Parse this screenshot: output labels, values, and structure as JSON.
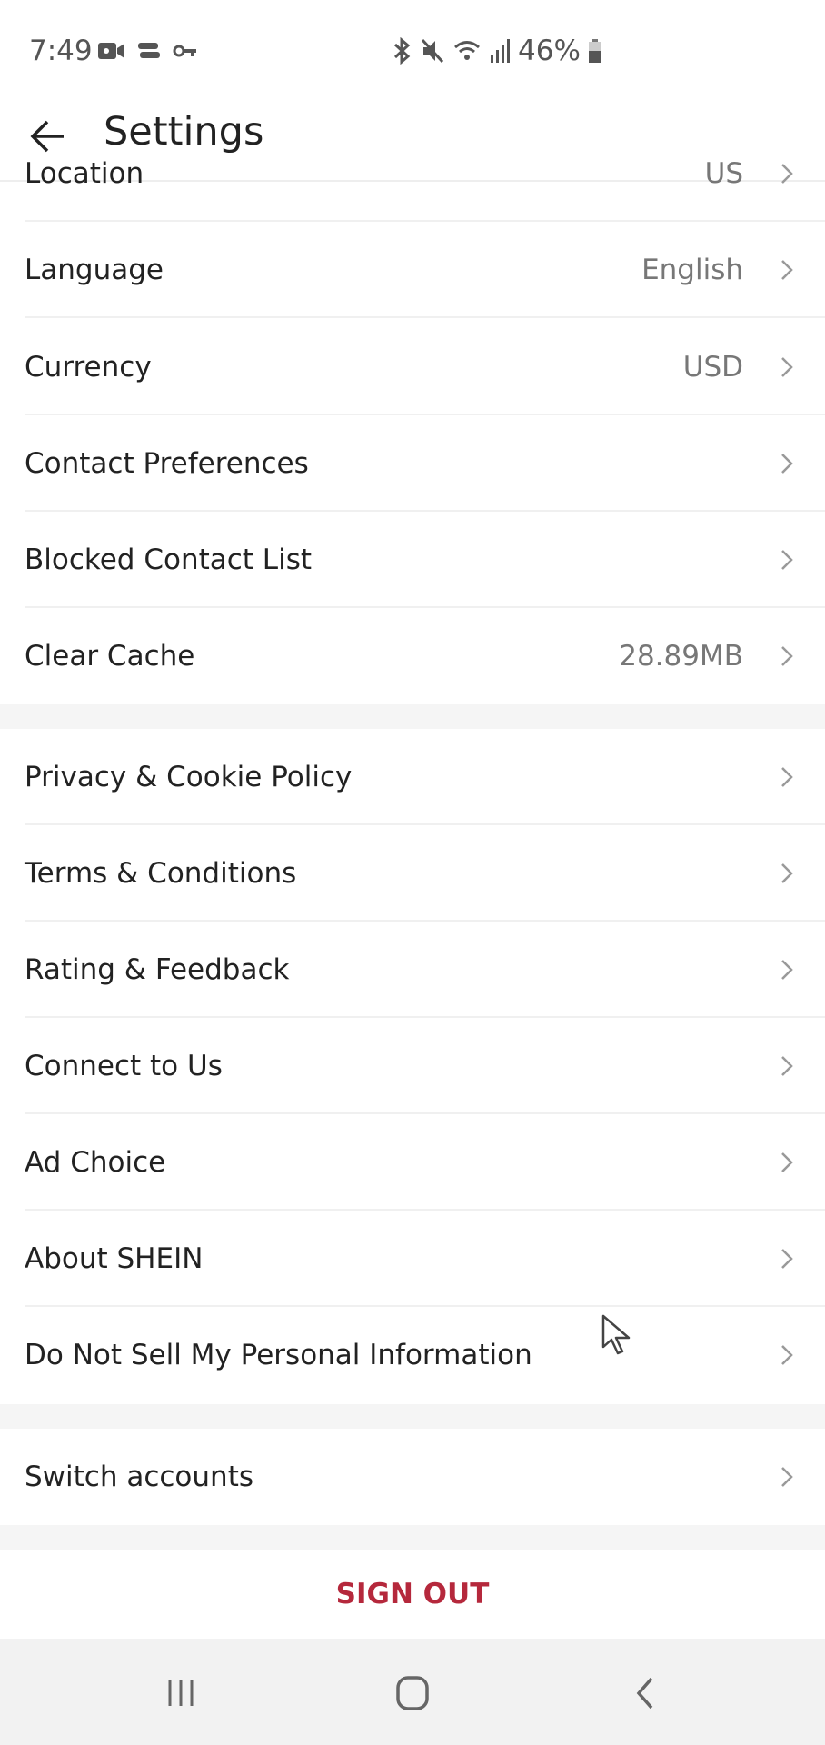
{
  "status_bar": {
    "time": "7:49",
    "left_icons": [
      "video-camera-icon",
      "cast-icon",
      "vpn-key-icon"
    ],
    "right_icons": [
      "bluetooth-icon",
      "mute-icon",
      "wifi-icon",
      "signal-icon"
    ],
    "battery": "46%"
  },
  "header": {
    "title": "Settings",
    "back_icon": "arrow-left-icon"
  },
  "sections": [
    {
      "items": [
        {
          "label": "Location",
          "value": "US"
        },
        {
          "label": "Language",
          "value": "English"
        },
        {
          "label": "Currency",
          "value": "USD"
        },
        {
          "label": "Contact Preferences",
          "value": ""
        },
        {
          "label": "Blocked Contact List",
          "value": ""
        },
        {
          "label": "Clear Cache",
          "value": "28.89MB"
        }
      ]
    },
    {
      "items": [
        {
          "label": "Privacy & Cookie Policy"
        },
        {
          "label": "Terms & Conditions"
        },
        {
          "label": "Rating & Feedback"
        },
        {
          "label": "Connect to Us"
        },
        {
          "label": "Ad Choice"
        },
        {
          "label": "About SHEIN"
        },
        {
          "label": "Do Not Sell My Personal Information"
        }
      ]
    },
    {
      "items": [
        {
          "label": "Switch accounts"
        }
      ]
    }
  ],
  "sign_out": {
    "label": "SIGN OUT",
    "color": "#b5283c"
  },
  "nav_bar": {
    "buttons": [
      "recent-apps-icon",
      "home-icon",
      "back-icon"
    ]
  }
}
